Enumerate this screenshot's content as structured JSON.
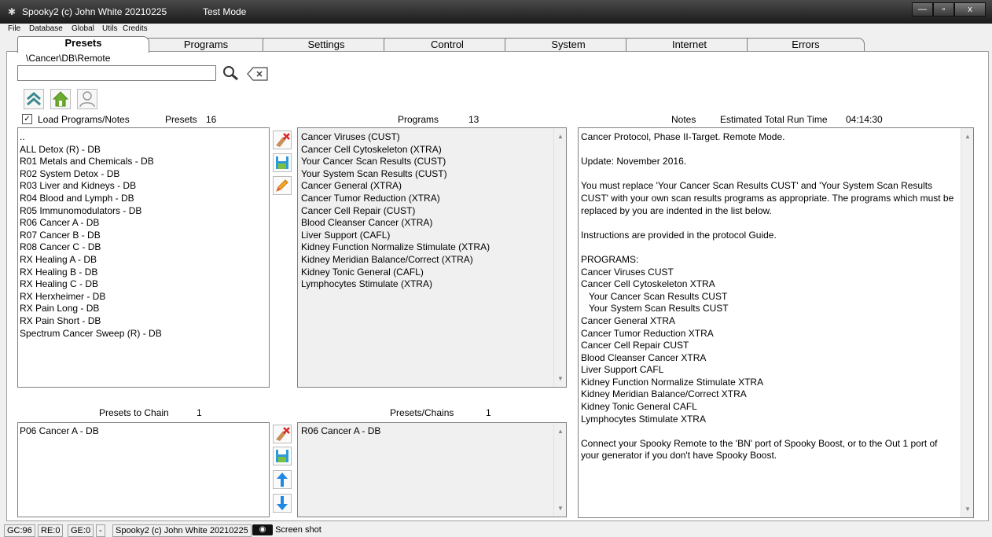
{
  "titlebar": {
    "title": "Spooky2 (c) John White 20210225",
    "mode": "Test Mode",
    "buttons": [
      "—",
      "▫",
      "x"
    ]
  },
  "menu": [
    "File",
    "Database",
    "Global",
    "Utils",
    "Credits"
  ],
  "tabs": [
    "Presets",
    "Programs",
    "Settings",
    "Control",
    "System",
    "Internet",
    "Errors"
  ],
  "path": "\\Cancer\\DB\\Remote",
  "search": {
    "value": ""
  },
  "presets_header": {
    "checkbox_label": "Load Programs/Notes",
    "label": "Presets",
    "count": "16"
  },
  "presets": [
    "..",
    "ALL Detox (R) - DB",
    "R01 Metals and Chemicals - DB",
    "R02 System Detox - DB",
    "R03 Liver and Kidneys - DB",
    "R04 Blood and Lymph - DB",
    "R05 Immunomodulators - DB",
    "R06 Cancer A - DB",
    "R07 Cancer B - DB",
    "R08 Cancer C - DB",
    "RX Healing A - DB",
    "RX Healing B - DB",
    "RX Healing C - DB",
    "RX Herxheimer - DB",
    "RX Pain Long - DB",
    "RX Pain Short - DB",
    "Spectrum Cancer Sweep (R) - DB"
  ],
  "programs_header": {
    "label": "Programs",
    "count": "13"
  },
  "programs": [
    "Cancer Viruses (CUST)",
    "Cancer Cell Cytoskeleton (XTRA)",
    "Your Cancer Scan Results (CUST)",
    "Your System Scan Results (CUST)",
    "Cancer General (XTRA)",
    "Cancer Tumor Reduction (XTRA)",
    "Cancer Cell Repair (CUST)",
    "Blood Cleanser Cancer (XTRA)",
    "Liver Support (CAFL)",
    "Kidney Function Normalize Stimulate (XTRA)",
    "Kidney Meridian Balance/Correct (XTRA)",
    "Kidney Tonic General (CAFL)",
    "Lymphocytes Stimulate (XTRA)"
  ],
  "notes_header": {
    "label": "Notes",
    "runtime_label": "Estimated Total Run Time",
    "runtime": "04:14:30"
  },
  "notes": {
    "p1": "Cancer Protocol, Phase II-Target. Remote Mode.",
    "p2": "Update: November 2016.",
    "p3": "You must replace 'Your Cancer Scan Results CUST' and 'Your System Scan Results CUST' with your own scan results programs as appropriate. The programs which must be replaced by you are indented in the list below.",
    "p4": "Instructions are provided in the protocol Guide.",
    "programs_heading": "PROGRAMS:",
    "program_lines": [
      {
        "text": "Cancer Viruses CUST",
        "indent": false
      },
      {
        "text": "Cancer Cell Cytoskeleton XTRA",
        "indent": false
      },
      {
        "text": "Your Cancer Scan Results CUST",
        "indent": true
      },
      {
        "text": "Your System Scan Results CUST",
        "indent": true
      },
      {
        "text": "Cancer General XTRA",
        "indent": false
      },
      {
        "text": "Cancer Tumor Reduction XTRA",
        "indent": false
      },
      {
        "text": "Cancer Cell Repair CUST",
        "indent": false
      },
      {
        "text": "Blood Cleanser Cancer XTRA",
        "indent": false
      },
      {
        "text": "Liver Support CAFL",
        "indent": false
      },
      {
        "text": "Kidney Function Normalize Stimulate XTRA",
        "indent": false
      },
      {
        "text": "Kidney Meridian Balance/Correct XTRA",
        "indent": false
      },
      {
        "text": "Kidney Tonic General CAFL",
        "indent": false
      },
      {
        "text": "Lymphocytes Stimulate XTRA",
        "indent": false
      }
    ],
    "p5": "Connect your Spooky Remote to the 'BN' port of Spooky Boost, or to the Out 1 port of your generator if you don't have Spooky Boost."
  },
  "chain_header": {
    "label": "Presets to Chain",
    "count": "1"
  },
  "chain": [
    "P06 Cancer A - DB"
  ],
  "presets_chains_header": {
    "label": "Presets/Chains",
    "count": "1"
  },
  "presets_chains": [
    "R06 Cancer A - DB"
  ],
  "status": {
    "gc": "GC:96",
    "re": "RE:0",
    "ge": "GE:0",
    "dash": "-",
    "title": "Spooky2 (c) John White 20210225",
    "screenshot": "Screen shot"
  }
}
